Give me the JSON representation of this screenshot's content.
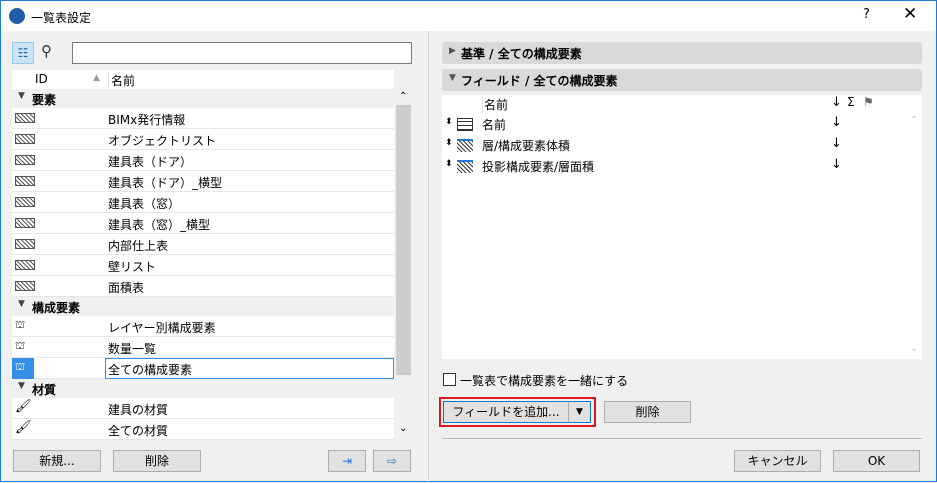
{
  "window": {
    "title": "一覧表設定",
    "help": "?",
    "close": "✕"
  },
  "left": {
    "search_placeholder": "",
    "columns": {
      "id": "ID",
      "name": "名前"
    },
    "groups": [
      {
        "label": "要素",
        "items": [
          "BIMx発行情報",
          "オブジェクトリスト",
          "建具表（ドア）",
          "建具表（ドア）_横型",
          "建具表（窓）",
          "建具表（窓）_横型",
          "内部仕上表",
          "壁リスト",
          "面積表"
        ]
      },
      {
        "label": "構成要素",
        "items": [
          "レイヤー別構成要素",
          "数量一覧",
          "全ての構成要素"
        ]
      },
      {
        "label": "材質",
        "items": [
          "建具の材質",
          "全ての材質"
        ]
      }
    ],
    "selected": "全ての構成要素",
    "new_button": "新規...",
    "delete_button": "削除"
  },
  "right": {
    "criteria_bar": "基準 /  全ての構成要素",
    "fields_bar": "フィールド /  全ての構成要素",
    "field_header": {
      "name": "名前",
      "sort": "↓",
      "sum": "Σ"
    },
    "fields": [
      {
        "name": "名前",
        "sort": "↓"
      },
      {
        "name": "層/構成要素体積",
        "sort": "↓"
      },
      {
        "name": "投影構成要素/層面積",
        "sort": "↓"
      }
    ],
    "merge_checkbox": "一覧表で構成要素を一緒にする",
    "merge_checked": false,
    "add_field_button": "フィールドを追加...",
    "delete_button": "削除",
    "cancel_button": "キャンセル",
    "ok_button": "OK"
  }
}
